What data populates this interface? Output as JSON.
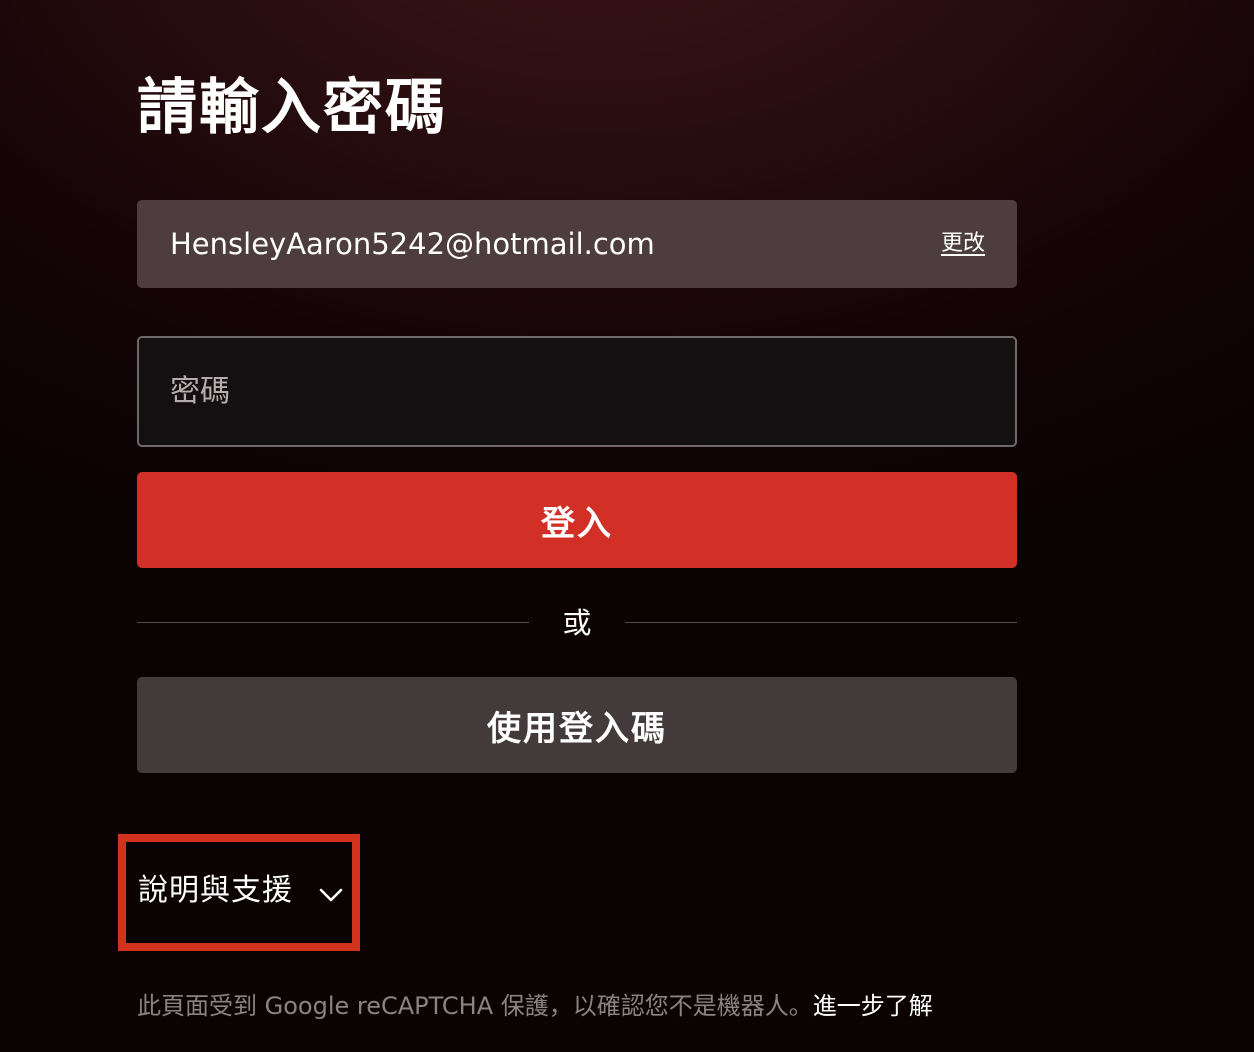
{
  "page": {
    "title": "請輸入密碼"
  },
  "account": {
    "email": "HensleyAaron5242@hotmail.com",
    "change_label": "更改"
  },
  "password": {
    "placeholder": "密碼",
    "value": ""
  },
  "buttons": {
    "login_label": "登入",
    "divider_text": "或",
    "use_code_label": "使用登入碼"
  },
  "help": {
    "label": "說明與支援",
    "icon": "chevron-down-icon",
    "highlight_color": "#d0321e"
  },
  "footer": {
    "recaptcha_text": "此頁面受到 Google reCAPTCHA 保護，以確認您不是機器人。",
    "learn_more_label": "進一步了解"
  },
  "colors": {
    "primary_button": "#d22f27",
    "secondary_button": "#433a3b",
    "email_box": "#4d3d3e"
  }
}
